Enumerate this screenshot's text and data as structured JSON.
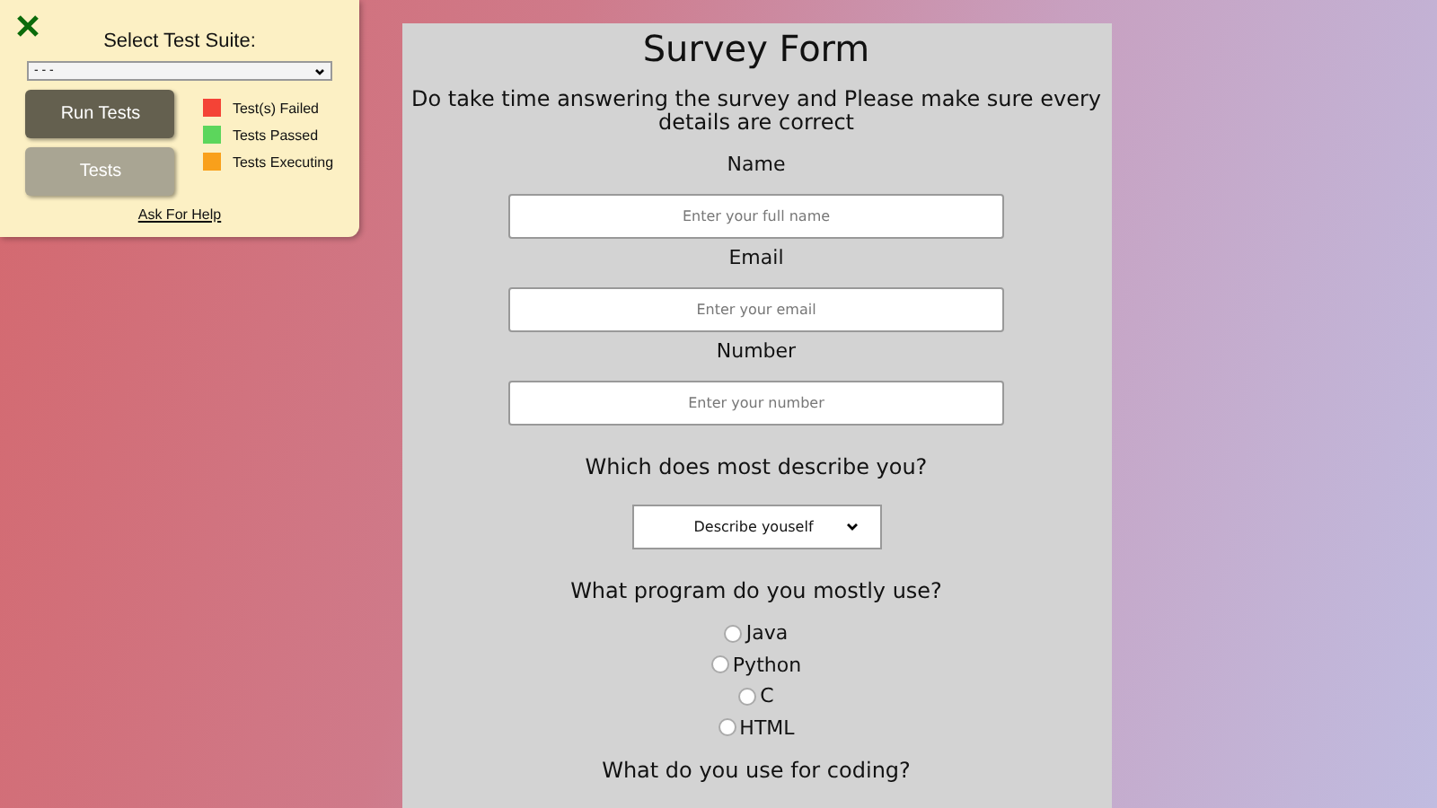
{
  "test_panel": {
    "title": "Select Test Suite:",
    "suite_select": {
      "value": "- - -"
    },
    "buttons": [
      {
        "label": "Run Tests",
        "kind": "primary"
      },
      {
        "label": "Tests",
        "kind": "secondary"
      }
    ],
    "legend": [
      {
        "label": "Test(s) Failed",
        "color": "#f44336"
      },
      {
        "label": "Tests Passed",
        "color": "#5cd65c"
      },
      {
        "label": "Tests Executing",
        "color": "#f9a01b"
      }
    ],
    "help_link": "Ask For Help"
  },
  "form": {
    "title": "Survey Form",
    "description": "Do take time answering the survey and Please make sure every details are correct",
    "fields": [
      {
        "label": "Name",
        "placeholder": "Enter your full name"
      },
      {
        "label": "Email",
        "placeholder": "Enter your email"
      },
      {
        "label": "Number",
        "placeholder": "Enter your number"
      }
    ],
    "describe": {
      "question": "Which does most describe you?",
      "value": "Describe youself"
    },
    "program": {
      "question": "What program do you mostly use?",
      "options": [
        {
          "label": "Java",
          "selected": false
        },
        {
          "label": "Python",
          "selected": false
        },
        {
          "label": "C",
          "selected": false
        },
        {
          "label": "HTML",
          "selected": false
        }
      ]
    },
    "next_question": "What do you use for coding?"
  }
}
